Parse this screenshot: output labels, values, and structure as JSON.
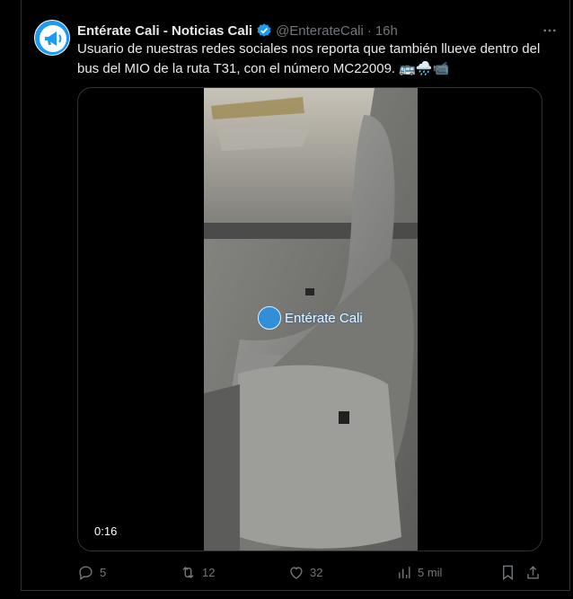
{
  "tweet": {
    "display_name": "Entérate Cali - Noticias Cali",
    "handle": "@EnterateCali",
    "dot": "·",
    "time": "16h",
    "text": "Usuario de nuestras redes sociales nos reporta que también llueve dentro del bus del MIO de la ruta T31, con el número MC22009. 🚌🌧️📹",
    "video_duration": "0:16",
    "watermark": "Entérate Cali"
  },
  "actions": {
    "replies": "5",
    "reposts": "12",
    "likes": "32",
    "views": "5 mil"
  },
  "colors": {
    "accent": "#1d9bf0",
    "text": "#e7e9ea",
    "muted": "#71767b",
    "border": "#2f3336"
  }
}
